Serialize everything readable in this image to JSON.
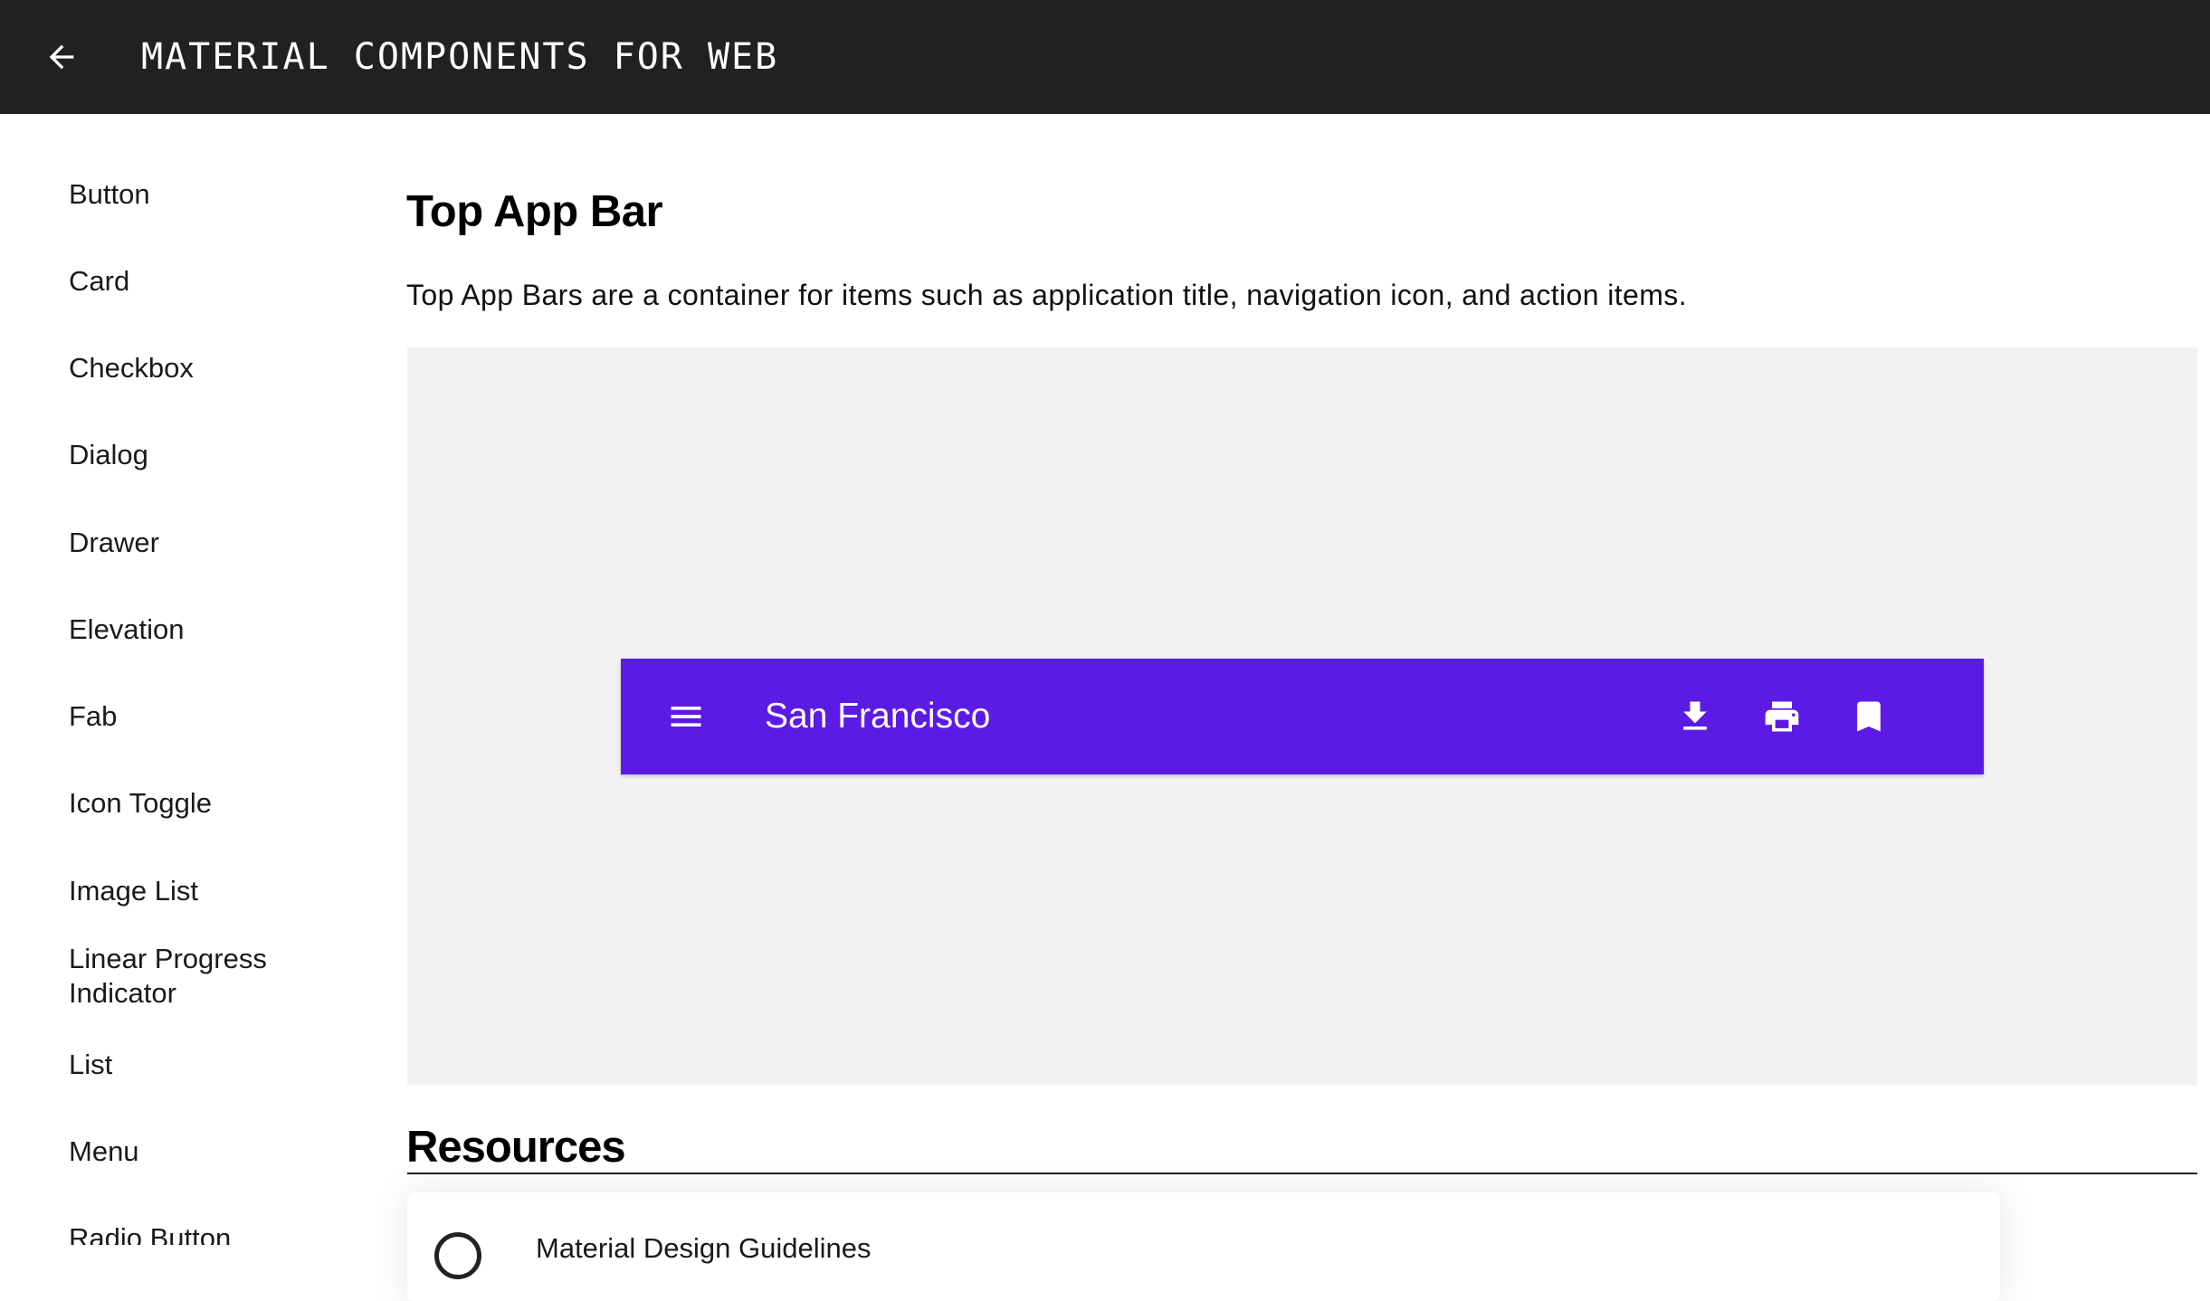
{
  "header": {
    "title": "MATERIAL COMPONENTS FOR WEB",
    "back_icon": "arrow-back-icon",
    "background_color": "#212121"
  },
  "sidebar": {
    "items": [
      {
        "label": "Button"
      },
      {
        "label": "Card"
      },
      {
        "label": "Checkbox"
      },
      {
        "label": "Dialog"
      },
      {
        "label": "Drawer"
      },
      {
        "label": "Elevation"
      },
      {
        "label": "Fab"
      },
      {
        "label": "Icon Toggle"
      },
      {
        "label": "Image List"
      },
      {
        "label": "Linear Progress Indicator"
      },
      {
        "label": "List"
      },
      {
        "label": "Menu"
      },
      {
        "label": "Radio Button"
      }
    ]
  },
  "main": {
    "title": "Top App Bar",
    "description": "Top App Bars are a container for items such as application title, navigation icon, and action items.",
    "demo": {
      "background_color": "#f2f2f2",
      "top_app_bar": {
        "title": "San Francisco",
        "background_color": "#5b1be5",
        "navigation_icon": "menu-icon",
        "actions": [
          {
            "icon": "download-icon"
          },
          {
            "icon": "print-icon"
          },
          {
            "icon": "bookmark-icon"
          }
        ]
      }
    },
    "resources": {
      "title": "Resources",
      "items": [
        {
          "label": "Material Design Guidelines",
          "icon": "material-design-icon"
        }
      ]
    }
  }
}
